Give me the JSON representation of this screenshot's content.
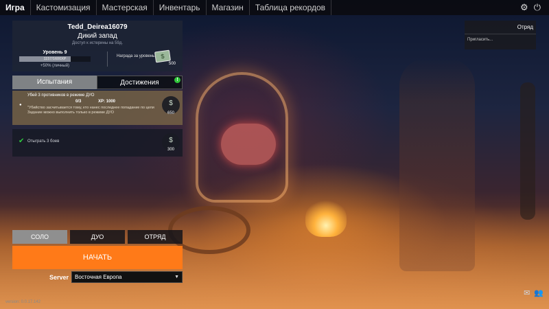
{
  "nav": {
    "tabs": [
      "Игра",
      "Кастомизация",
      "Мастерская",
      "Инвентарь",
      "Магазин",
      "Таблица рекордов"
    ],
    "icons": [
      "gear-icon",
      "power-icon"
    ]
  },
  "profile": {
    "username": "Tedd_Deirea16079",
    "map_name": "Дикий запад",
    "access_note": "Доступ к истерины на 59д.",
    "level_label": "Уровень 9",
    "xp_text": "1157/1600XP",
    "xp_progress": 0.72,
    "xp_bonus": "+50% (личный)",
    "reward_label": "Награда за уровень:",
    "reward_value": "500"
  },
  "subtabs": {
    "challenges": "Испытания",
    "achievements": "Достижения",
    "achievements_badge": "!"
  },
  "challenges": [
    {
      "title": "Убей 3 противников в режиме ДУО",
      "progress": "0/3",
      "xp": "XP: 1000",
      "desc_line1": "\"Убийство засчитывается тому, кто нанес последнее попадание по цели",
      "desc_line2": "Задание можно выполнить только в режиме ДУО",
      "reward": "650"
    },
    {
      "title": "Отыграть 3 боев",
      "reward": "300"
    }
  ],
  "modes": {
    "solo": "СОЛО",
    "duo": "ДУО",
    "squad": "ОТРЯД"
  },
  "start_label": "НАЧАТЬ",
  "server": {
    "label": "Server",
    "value": "Восточная Европа"
  },
  "version": "version: 0.0.17.142",
  "squad_panel": {
    "title": "Отряд",
    "invite": "Пригласить..."
  },
  "colors": {
    "accent": "#ff7a18",
    "challenge_active": "#786446",
    "badge": "#30c43a"
  }
}
